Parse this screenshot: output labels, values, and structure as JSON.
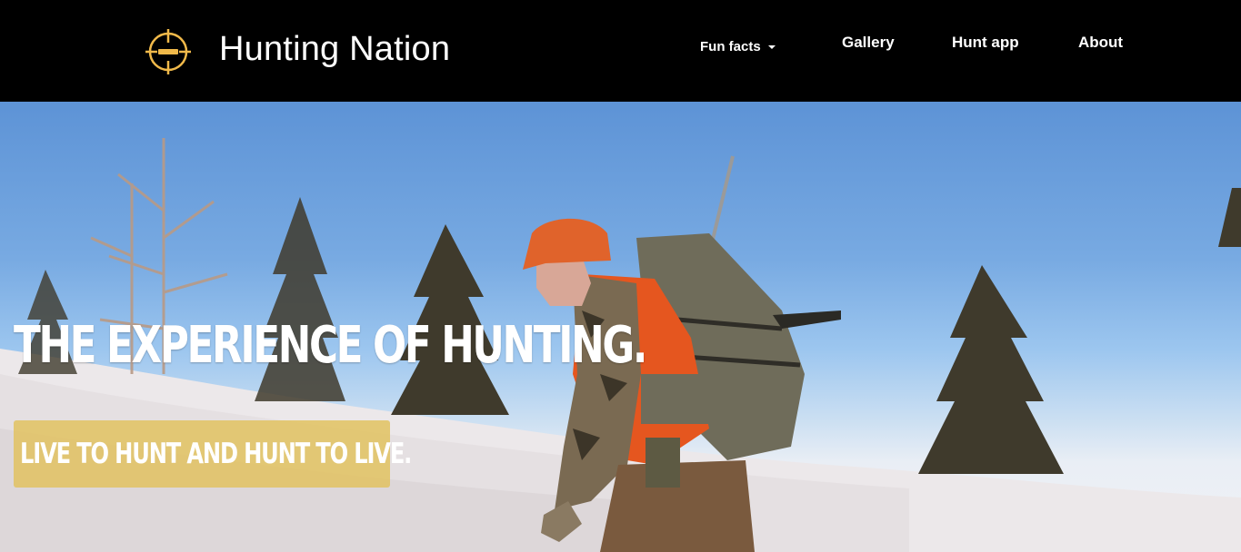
{
  "header": {
    "brand": "Hunting Nation",
    "logo_icon": "crosshair-icon",
    "nav": {
      "fun_facts": "Fun facts",
      "gallery": "Gallery",
      "hunt_app": "Hunt app",
      "about": "About"
    }
  },
  "hero": {
    "headline": "THE EXPERIENCE OF HUNTING.",
    "tagline": "LIVE TO HUNT AND HUNT TO LIVE."
  },
  "colors": {
    "accent": "#f0b94a",
    "tagline_bg": "#e2c260",
    "nav_bg": "#000000"
  }
}
